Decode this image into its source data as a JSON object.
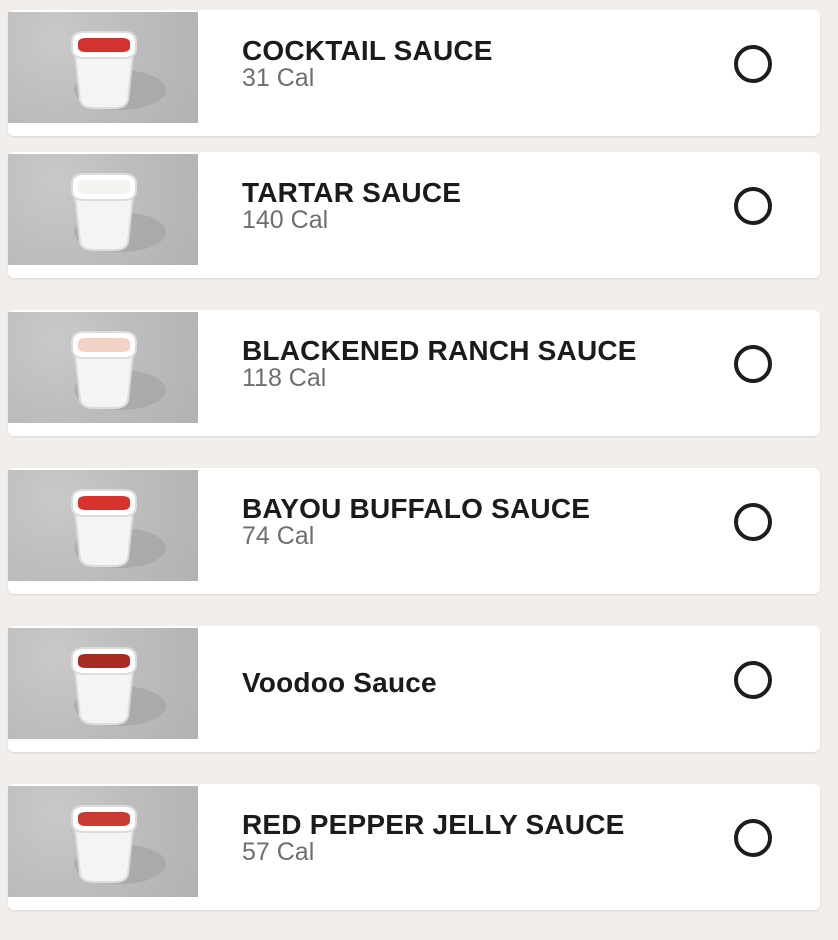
{
  "items": [
    {
      "name": "COCKTAIL SAUCE",
      "calories": "31 Cal",
      "sauce_color": "#d2332e",
      "selected": false
    },
    {
      "name": "TARTAR SAUCE",
      "calories": "140 Cal",
      "sauce_color": "#f3f3f0",
      "selected": false
    },
    {
      "name": "BLACKENED RANCH SAUCE",
      "calories": "118 Cal",
      "sauce_color": "#f1d2c5",
      "selected": false
    },
    {
      "name": "BAYOU BUFFALO SAUCE",
      "calories": "74 Cal",
      "sauce_color": "#d7332c",
      "selected": false
    },
    {
      "name": "Voodoo Sauce",
      "calories": "",
      "sauce_color": "#a82b22",
      "selected": false
    },
    {
      "name": "RED PEPPER JELLY SAUCE",
      "calories": "57 Cal",
      "sauce_color": "#c93a33",
      "selected": false
    }
  ],
  "colors": {
    "background": "#f1eeec",
    "card": "#ffffff",
    "text": "#1b1b1b",
    "muted": "#6e6e6e",
    "radio": "#1d1d1d"
  }
}
